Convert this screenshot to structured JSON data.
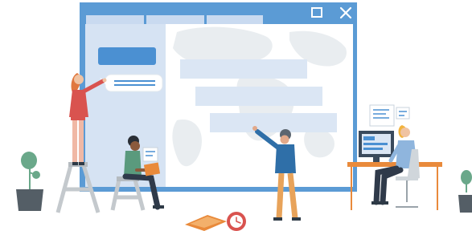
{
  "window": {
    "tabs": [
      {
        "label": ""
      },
      {
        "label": ""
      },
      {
        "label": ""
      }
    ],
    "sidebar_button_label": "",
    "chat_bubble_lines": [
      "",
      ""
    ],
    "content_bars": [
      {
        "label": ""
      },
      {
        "label": ""
      },
      {
        "label": ""
      }
    ],
    "icons": [
      "maximize-icon",
      "close-icon"
    ]
  },
  "colors": {
    "window_frame": "#5b9bd5",
    "titlebar": "#5b9bd5",
    "tab": "#c9daf0",
    "sidebar": "#d6e3f3",
    "sidebar_button": "#4b90d2",
    "content_bar": "#dbe6f4",
    "map": "#e8ecef",
    "desk_orange": "#e98a3b",
    "person_red": "#d9534f",
    "person_blue": "#2f6fa8",
    "plant_green": "#6aa88a",
    "pot_gray": "#545e66",
    "ladder_gray": "#bfc4c8"
  },
  "illustration": {
    "figures": [
      "woman-on-ladder",
      "man-with-laptop",
      "man-pointing",
      "woman-at-desk"
    ],
    "plants": [
      "plant-left",
      "plant-right"
    ],
    "floor_items": [
      "open-book",
      "clock"
    ]
  }
}
